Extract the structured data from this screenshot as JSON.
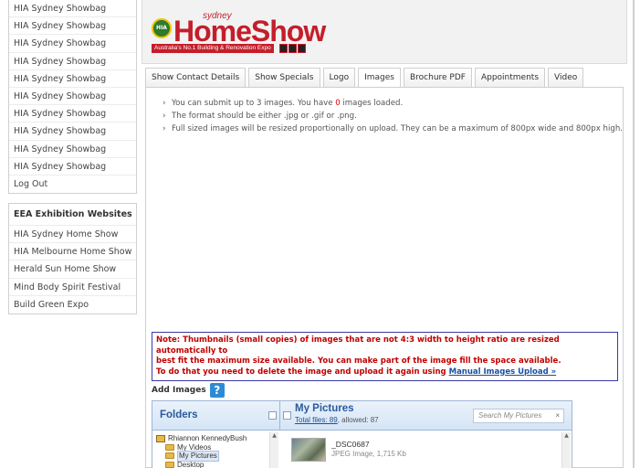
{
  "sidebar": {
    "items": [
      "HIA Sydney Showbag",
      "HIA Sydney Showbag",
      "HIA Sydney Showbag",
      "HIA Sydney Showbag",
      "HIA Sydney Showbag",
      "HIA Sydney Showbag",
      "HIA Sydney Showbag",
      "HIA Sydney Showbag",
      "HIA Sydney Showbag",
      "HIA Sydney Showbag",
      "Log Out"
    ],
    "exhibition": {
      "heading": "EEA Exhibition Websites",
      "items": [
        "HIA Sydney Home Show",
        "HIA Melbourne Home Show",
        "Herald Sun Home Show",
        "Mind Body Spirit Festival",
        "Build Green Expo"
      ]
    }
  },
  "logo": {
    "badge": "HIA",
    "sydney": "sydney",
    "word": "HomeShow",
    "tagline": "Australia's No.1 Building & Renovation Expo"
  },
  "tabs": [
    "Show Contact Details",
    "Show Specials",
    "Logo",
    "Images",
    "Brochure PDF",
    "Appointments",
    "Video"
  ],
  "active_tab": "Images",
  "info": {
    "line1_pre": "You can submit up to 3 images. You have ",
    "line1_count": "0",
    "line1_post": " images loaded.",
    "line2": "The format should be either .jpg or .gif or .png.",
    "line3": "Full sized images will be resized proportionally on upload. They can be a maximum of 800px wide and 800px high."
  },
  "note": {
    "line1": "Note: Thumbnails (small copies) of images that are not 4:3 width to height ratio are resized automatically to",
    "line2": "best fit the maximum size available. You can make part of the image fill the space available.",
    "line3_pre": "To do that you need to delete the image and upload it again using ",
    "line3_link": "Manual Images Upload »"
  },
  "add_images": {
    "label": "Add Images",
    "help": "?"
  },
  "browser": {
    "folders_title": "Folders",
    "pictures_title": "My Pictures",
    "total_files_link": "Total files: 89",
    "allowed_text": ", allowed: 87",
    "search_placeholder": "Search My Pictures",
    "search_clear": "×",
    "tree": [
      {
        "label": "Rhiannon KennedyBush",
        "level": 0
      },
      {
        "label": "My Videos",
        "level": 1
      },
      {
        "label": "My Pictures",
        "level": 1,
        "selected": true
      },
      {
        "label": "Desktop",
        "level": 1
      }
    ],
    "file": {
      "name": "_DSC0687",
      "meta": "JPEG Image, 1,715 Kb"
    }
  }
}
